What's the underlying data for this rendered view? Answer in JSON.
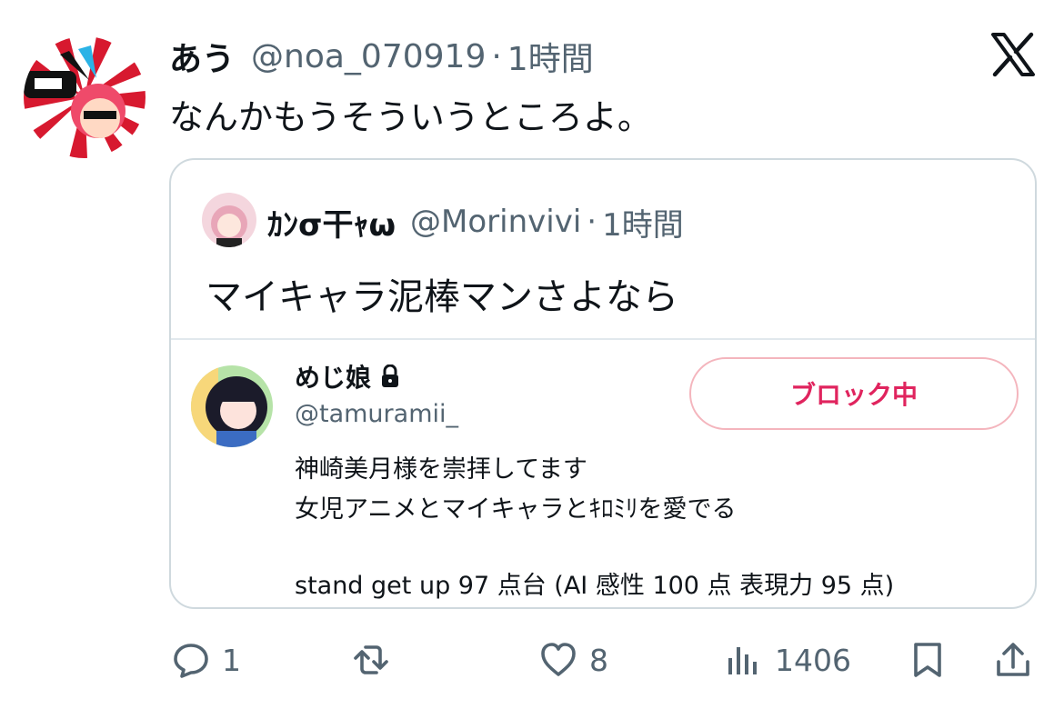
{
  "tweet": {
    "author_name": "あう",
    "author_handle": "@noa_070919",
    "separator": "·",
    "time": "1時間",
    "text": "なんかもうそういうところよ。"
  },
  "quote": {
    "author_name": "ｶﾝσ干ｬω",
    "author_handle": "@Morinvivi",
    "separator": "·",
    "time": "1時間",
    "text": "マイキャラ泥棒マンさよなら",
    "profile": {
      "name": "めじ娘",
      "handle": "@tamuramii_",
      "block_button_label": "ブロック中",
      "bio_lines": [
        "神崎美月様を崇拝してます",
        "女児アニメとマイキャラとｷﾛﾐﾘを愛でる",
        "",
        "stand get up 97 点台 (AI 感性 100 点  表現力 95 点)"
      ]
    }
  },
  "actions": {
    "replies": "1",
    "retweets": "",
    "likes": "8",
    "views": "1406"
  },
  "colors": {
    "text_primary": "#0f1419",
    "text_secondary": "#536471",
    "border": "#cfd9de",
    "block_red": "#e0245e"
  },
  "icons": [
    "x-logo-icon",
    "lock-icon",
    "reply-icon",
    "retweet-icon",
    "like-icon",
    "views-icon",
    "bookmark-icon",
    "share-icon"
  ]
}
